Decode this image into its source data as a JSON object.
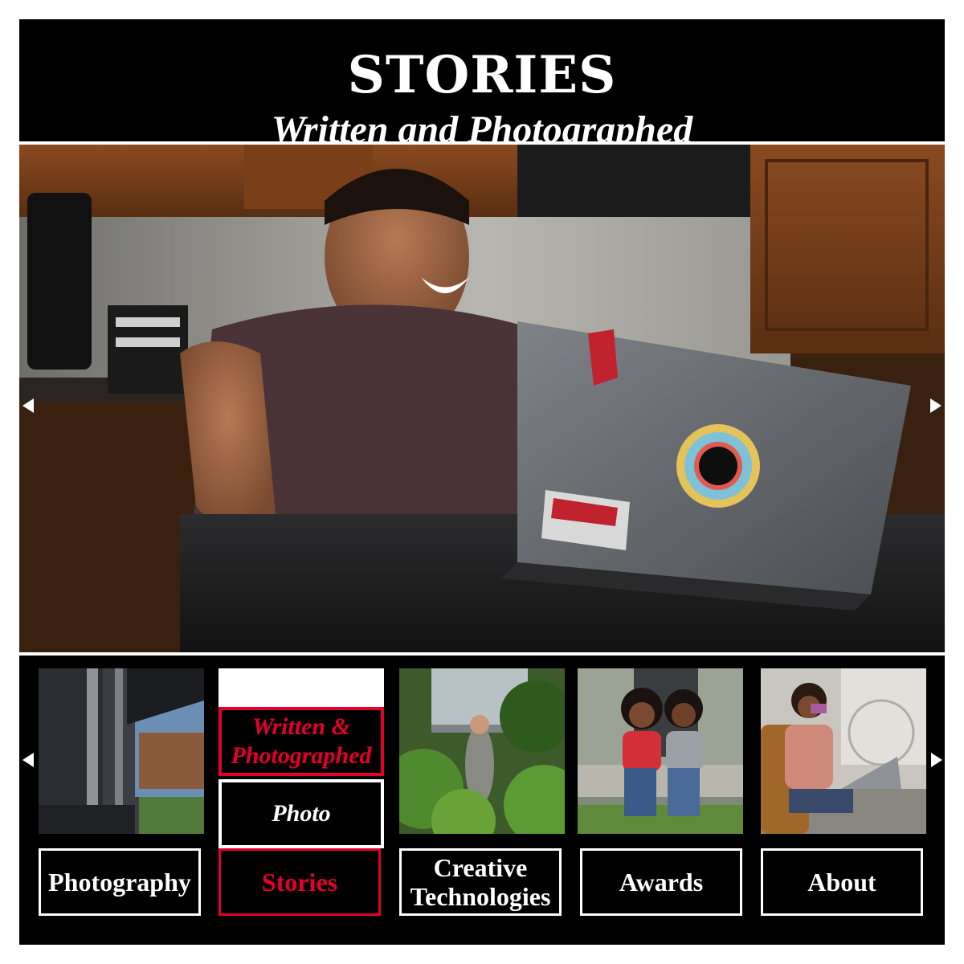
{
  "header": {
    "title": "STORIES",
    "subtitle": "Written and Photographed"
  },
  "hero": {
    "image": "smiling-student-at-laptop-photo",
    "prev_icon": "triangle-left-icon",
    "next_icon": "triangle-right-icon"
  },
  "nav": {
    "items": [
      {
        "label": "Photography",
        "thumbnail": "campus-atrium-photo"
      },
      {
        "label": "Stories",
        "thumbnail": ""
      },
      {
        "label": "Creative Technologies",
        "label_line1": "Creative",
        "label_line2": "Technologies",
        "thumbnail": "greenhouse-photo"
      },
      {
        "label": "Awards",
        "thumbnail": "two-students-on-steps-photo"
      },
      {
        "label": "About",
        "thumbnail": "student-with-laptop-photo"
      }
    ],
    "submenu": [
      {
        "label_line1": "Written &",
        "label_line2": "Photographed"
      },
      {
        "label": "Photo"
      }
    ],
    "prev_icon": "triangle-left-icon",
    "next_icon": "triangle-right-icon"
  },
  "colors": {
    "accent": "#e4002b",
    "background": "#000000",
    "text": "#ffffff"
  }
}
